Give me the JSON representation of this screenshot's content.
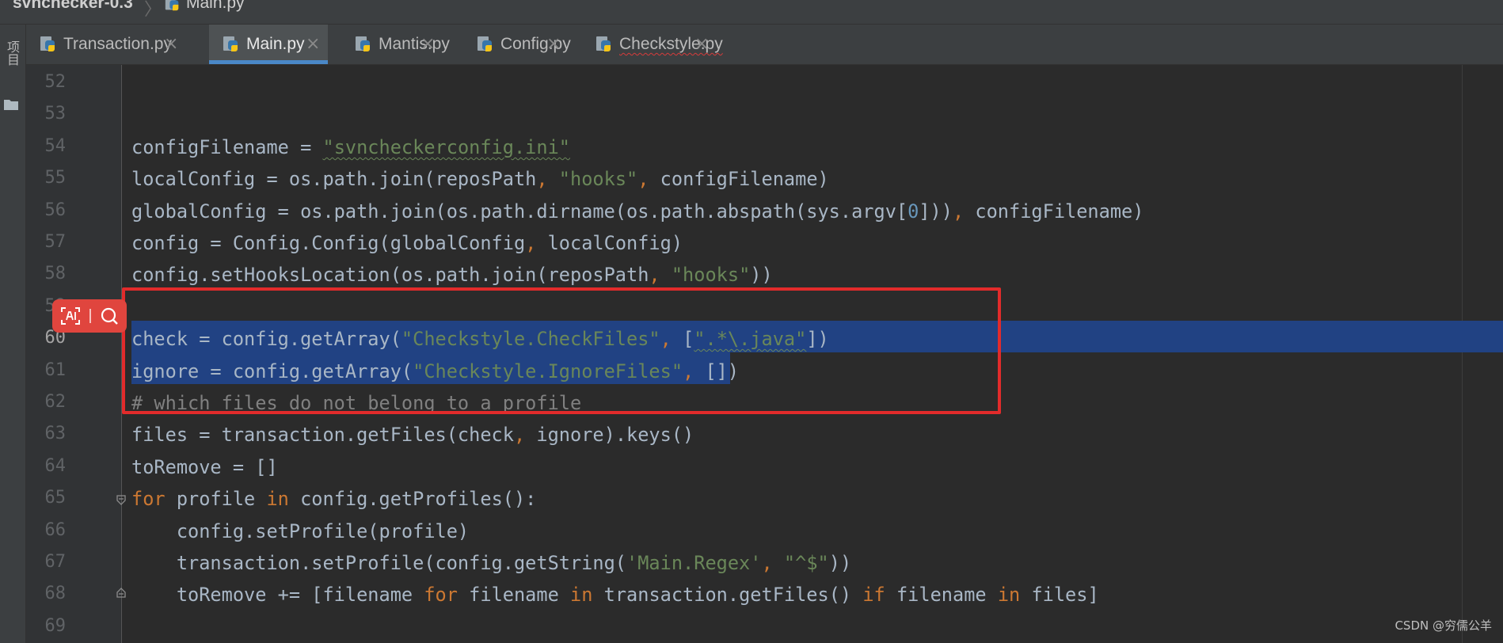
{
  "breadcrumb": {
    "project": "svnchecker-0.3",
    "separator": "〉",
    "file": "Main.py"
  },
  "toolstrip": {
    "label": "项目",
    "icon": "folder-icon"
  },
  "tabs": [
    {
      "label": "Transaction.py",
      "icon": "python-file-icon",
      "active": false,
      "close": "×"
    },
    {
      "label": "Main.py",
      "icon": "python-file-icon",
      "active": true,
      "close": "×"
    },
    {
      "label": "Mantis.py",
      "icon": "python-file-icon",
      "active": false,
      "close": "×"
    },
    {
      "label": "Config.py",
      "icon": "python-file-icon",
      "active": false,
      "close": "×"
    },
    {
      "label": "Checkstyle.py",
      "icon": "python-file-icon",
      "active": false,
      "close": "×",
      "squiggle": true
    }
  ],
  "colors": {
    "accent": "#4a88c7",
    "selection": "#214283",
    "highlight_box": "#e22b2b",
    "string": "#6a8759",
    "keyword": "#cc7832",
    "number": "#6897bb",
    "comment": "#808080"
  },
  "editor": {
    "current_line": "60",
    "lines": [
      {
        "num": "52",
        "tokens": []
      },
      {
        "num": "53",
        "tokens": []
      },
      {
        "num": "54",
        "tokens": [
          [
            "configFilename = ",
            "plain"
          ],
          [
            "\"svncheckerconfig.ini\"",
            "strsq"
          ]
        ]
      },
      {
        "num": "55",
        "tokens": [
          [
            "localConfig = os.path.join(reposPath",
            "plain"
          ],
          [
            ", ",
            "kw"
          ],
          [
            "\"hooks\"",
            "str"
          ],
          [
            ", ",
            "kw"
          ],
          [
            "configFilename)",
            "plain"
          ]
        ]
      },
      {
        "num": "56",
        "tokens": [
          [
            "globalConfig = os.path.join(os.path.dirname(os.path.abspath(sys.argv[",
            "plain"
          ],
          [
            "0",
            "num"
          ],
          [
            "]))",
            "plain"
          ],
          [
            ", ",
            "kw"
          ],
          [
            "configFilename)",
            "plain"
          ]
        ]
      },
      {
        "num": "57",
        "tokens": [
          [
            "config = Config.Config(globalConfig",
            "plain"
          ],
          [
            ", ",
            "kw"
          ],
          [
            "localConfig)",
            "plain"
          ]
        ]
      },
      {
        "num": "58",
        "tokens": [
          [
            "config.setHooksLocation(os.path.join(reposPath",
            "plain"
          ],
          [
            ", ",
            "kw"
          ],
          [
            "\"hooks\"",
            "str"
          ],
          [
            "))",
            "plain"
          ]
        ]
      },
      {
        "num": "59",
        "tokens": []
      },
      {
        "num": "60",
        "tokens": [
          [
            "check = config.getArray(",
            "plain"
          ],
          [
            "\"Checkstyle.CheckFiles\"",
            "str"
          ],
          [
            ", ",
            "kw"
          ],
          [
            "[",
            "plain"
          ],
          [
            "\".*\\.java\"",
            "strsq"
          ],
          [
            "])",
            "plain"
          ]
        ]
      },
      {
        "num": "61",
        "tokens": [
          [
            "ignore = config.getArray(",
            "plain"
          ],
          [
            "\"Checkstyle.IgnoreFiles\"",
            "str"
          ],
          [
            ", ",
            "kw"
          ],
          [
            "[])",
            "plain"
          ]
        ]
      },
      {
        "num": "62",
        "tokens": [
          [
            "# which files do not belong to a profile",
            "comment"
          ]
        ]
      },
      {
        "num": "63",
        "tokens": [
          [
            "files = transaction.getFiles(check",
            "plain"
          ],
          [
            ", ",
            "kw"
          ],
          [
            "ignore).keys()",
            "plain"
          ]
        ]
      },
      {
        "num": "64",
        "tokens": [
          [
            "toRemove = []",
            "plain"
          ]
        ]
      },
      {
        "num": "65",
        "tokens": [
          [
            "for ",
            "kw"
          ],
          [
            "profile ",
            "plain"
          ],
          [
            "in ",
            "kw"
          ],
          [
            "config.getProfiles():",
            "plain"
          ]
        ]
      },
      {
        "num": "66",
        "tokens": [
          [
            "    config.setProfile(profile)",
            "plain"
          ]
        ]
      },
      {
        "num": "67",
        "tokens": [
          [
            "    transaction.setProfile(config.getString(",
            "plain"
          ],
          [
            "'Main.Regex'",
            "str"
          ],
          [
            ", ",
            "kw"
          ],
          [
            "\"^$\"",
            "str"
          ],
          [
            "))",
            "plain"
          ]
        ]
      },
      {
        "num": "68",
        "tokens": [
          [
            "    toRemove += [filename ",
            "plain"
          ],
          [
            "for ",
            "kw"
          ],
          [
            "filename ",
            "plain"
          ],
          [
            "in ",
            "kw"
          ],
          [
            "transaction.getFiles() ",
            "plain"
          ],
          [
            "if ",
            "kw"
          ],
          [
            "filename ",
            "plain"
          ],
          [
            "in ",
            "kw"
          ],
          [
            "files]",
            "plain"
          ]
        ]
      },
      {
        "num": "69",
        "tokens": []
      }
    ]
  },
  "floating_toolbar": {
    "ai_icon": "ai-icon",
    "search_icon": "search-icon"
  },
  "watermark": "CSDN @穷儒公羊"
}
